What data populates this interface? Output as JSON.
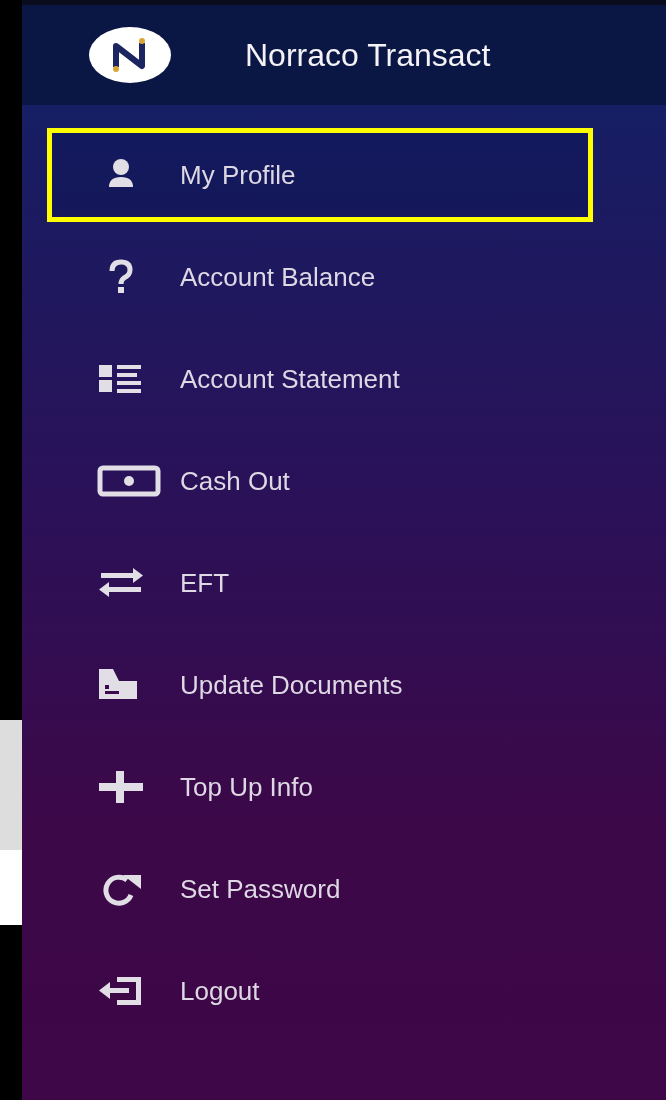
{
  "header": {
    "title": "Norraco Transact"
  },
  "menu": [
    {
      "label": "My Profile",
      "selected": true
    },
    {
      "label": "Account Balance",
      "selected": false
    },
    {
      "label": "Account Statement",
      "selected": false
    },
    {
      "label": "Cash Out",
      "selected": false
    },
    {
      "label": "EFT",
      "selected": false
    },
    {
      "label": "Update Documents",
      "selected": false
    },
    {
      "label": "Top Up Info",
      "selected": false
    },
    {
      "label": "Set Password",
      "selected": false
    },
    {
      "label": "Logout",
      "selected": false
    }
  ]
}
